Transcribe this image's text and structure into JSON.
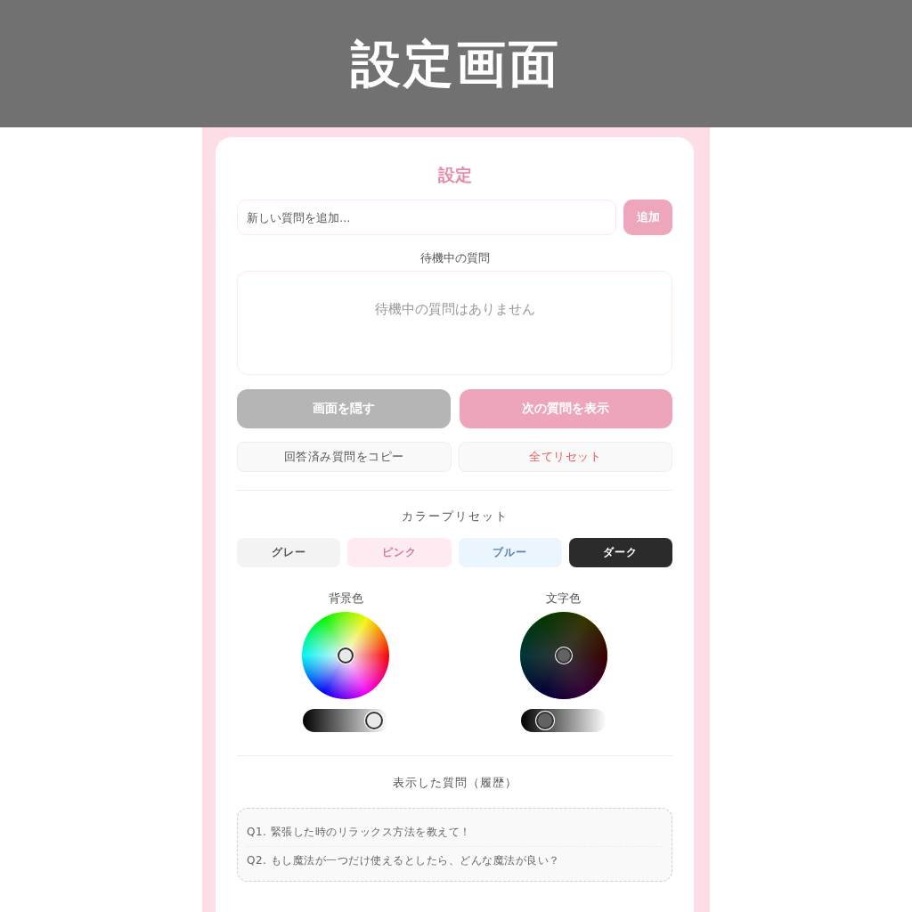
{
  "banner": {
    "title": "設定画面"
  },
  "panel": {
    "title": "設定",
    "new_question": {
      "placeholder": "新しい質問を追加...",
      "button": "追加"
    },
    "pending": {
      "label": "待機中の質問",
      "empty_text": "待機中の質問はありません"
    },
    "actions": [
      {
        "label": "画面を隠す",
        "kind": "muted"
      },
      {
        "label": "次の質問を表示",
        "kind": "primary"
      }
    ],
    "tools": [
      {
        "label": "回答済み質問をコピー",
        "kind": "plain"
      },
      {
        "label": "全てリセット",
        "kind": "danger"
      }
    ],
    "color_presets": {
      "label": "カラープリセット",
      "items": [
        {
          "label": "グレー",
          "kind": "gray",
          "color": "#f3f3f3"
        },
        {
          "label": "ピンク",
          "kind": "pink",
          "color": "#fdebf1"
        },
        {
          "label": "ブルー",
          "kind": "blue",
          "color": "#ebf5fd"
        },
        {
          "label": "ダーク",
          "kind": "dark",
          "color": "#2b2b2b"
        }
      ]
    },
    "pickers": [
      {
        "label": "背景色",
        "level": 0.96
      },
      {
        "label": "文字色",
        "level": 0.21
      }
    ],
    "history": {
      "label": "表示した質問（履歴）",
      "items": [
        "Q1. 緊張した時のリラックス方法を教えて！",
        "Q2. もし魔法が一つだけ使えるとしたら、どんな魔法が良い？"
      ]
    }
  }
}
